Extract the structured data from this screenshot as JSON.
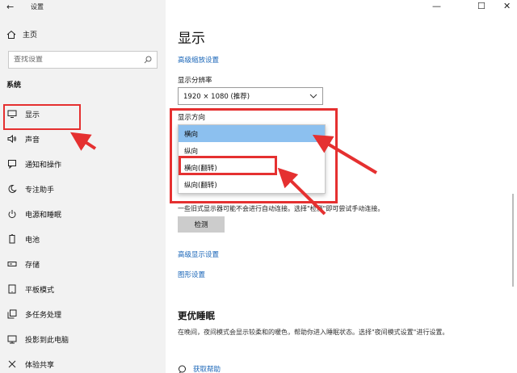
{
  "window": {
    "title": "设置",
    "back_glyph": "←",
    "minimize_glyph": "—",
    "maximize_glyph": "☐",
    "close_glyph": "✕"
  },
  "sidebar": {
    "home": {
      "label": "主页",
      "icon": "home-icon"
    },
    "search": {
      "placeholder": "查找设置",
      "icon": "search-icon"
    },
    "section_heading": "系统",
    "items": [
      {
        "label": "显示",
        "icon": "monitor-icon",
        "glyph": "▭",
        "active": true
      },
      {
        "label": "声音",
        "icon": "speaker-icon",
        "glyph": "🔈︎"
      },
      {
        "label": "通知和操作",
        "icon": "notification-icon",
        "glyph": "▢"
      },
      {
        "label": "专注助手",
        "icon": "moon-icon",
        "glyph": "☾"
      },
      {
        "label": "电源和睡眠",
        "icon": "power-icon",
        "glyph": "⏻"
      },
      {
        "label": "电池",
        "icon": "battery-icon",
        "glyph": "▭"
      },
      {
        "label": "存储",
        "icon": "storage-icon",
        "glyph": "▬"
      },
      {
        "label": "平板模式",
        "icon": "tablet-icon",
        "glyph": "▯"
      },
      {
        "label": "多任务处理",
        "icon": "multitask-icon",
        "glyph": "⧉"
      },
      {
        "label": "投影到此电脑",
        "icon": "project-icon",
        "glyph": "⊟"
      },
      {
        "label": "体验共享",
        "icon": "share-icon",
        "glyph": "✕"
      }
    ]
  },
  "main": {
    "title": "显示",
    "advanced_scaling_link": "高级缩放设置",
    "resolution_label": "显示分辨率",
    "resolution_value": "1920 × 1080 (推荐)",
    "orientation_label": "显示方向",
    "orientation_options": [
      "横向",
      "纵向",
      "横向(翻转)",
      "纵向(翻转)"
    ],
    "selected_orientation": "横向",
    "detect_description": "一些旧式显示器可能不会进行自动连接。选择\"检测\"即可尝试手动连接。",
    "detect_button": "检测",
    "advanced_display_link": "高级显示设置",
    "graphics_link": "图形设置",
    "sleep_heading": "更优睡眠",
    "sleep_description": "在晚间，夜间模式会显示较柔和的暖色，帮助你进入睡眠状态。选择\"夜间模式设置\"进行设置。",
    "help_link": "获取帮助"
  },
  "annotation_color": "#e53030",
  "accent_color": "#1a66b8",
  "selected_color": "#8cc0ef"
}
